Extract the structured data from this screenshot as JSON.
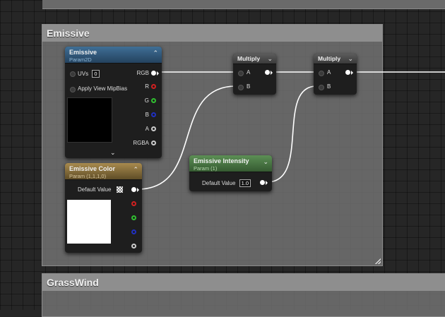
{
  "comments": {
    "emissive_title": "Emissive",
    "grasswind_title": "GrassWind"
  },
  "emissive_node": {
    "title": "Emissive",
    "subtitle": "Param2D",
    "uvs_label": "UVs",
    "uvs_value": "0",
    "mipbias_label": "Apply View MipBias",
    "outputs": [
      "RGB",
      "R",
      "G",
      "B",
      "A",
      "RGBA"
    ],
    "preview_color": "#000000"
  },
  "emissive_color_node": {
    "title": "Emissive Color",
    "subtitle": "Param (1,1,1,0)",
    "default_label": "Default Value",
    "preview_color": "#ffffff"
  },
  "emissive_intensity_node": {
    "title": "Emissive Intensity",
    "subtitle": "Param (1)",
    "default_label": "Default Value",
    "default_value": "1.0"
  },
  "multiply_1": {
    "title": "Multiply",
    "input_a": "A",
    "input_b": "B"
  },
  "multiply_2": {
    "title": "Multiply",
    "input_a": "A",
    "input_b": "B"
  },
  "colors": {
    "pin_red": "#d02020",
    "pin_green": "#30c030",
    "pin_blue": "#2030c0",
    "pin_white": "#ffffff"
  }
}
